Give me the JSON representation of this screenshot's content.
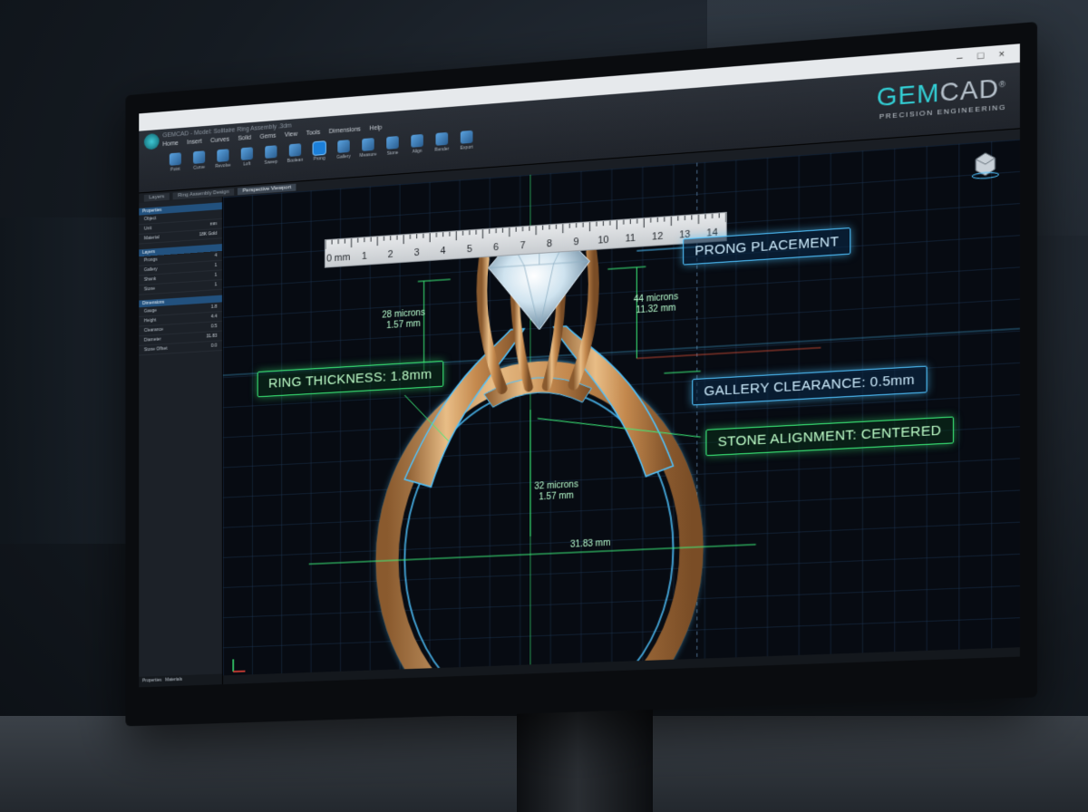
{
  "window": {
    "doc_title": "GEMCAD - Model: Solitaire Ring Assembly .3dm",
    "controls": [
      "–",
      "□",
      "×"
    ]
  },
  "menu": [
    "Home",
    "Insert",
    "Curves",
    "Solid",
    "Gems",
    "View",
    "Tools",
    "Dimensions",
    "Help"
  ],
  "tools": [
    {
      "label": "Point",
      "icon": "point-icon"
    },
    {
      "label": "Curve",
      "icon": "curve-icon"
    },
    {
      "label": "Revolve",
      "icon": "revolve-icon"
    },
    {
      "label": "Loft",
      "icon": "loft-icon"
    },
    {
      "label": "Sweep",
      "icon": "sweep-icon"
    },
    {
      "label": "Boolean",
      "icon": "boolean-icon"
    },
    {
      "label": "Prong",
      "icon": "prong-icon"
    },
    {
      "label": "Gallery",
      "icon": "gallery-icon"
    },
    {
      "label": "Measure",
      "icon": "measure-icon"
    },
    {
      "label": "Stone",
      "icon": "stone-icon"
    },
    {
      "label": "Align",
      "icon": "align-icon"
    },
    {
      "label": "Render",
      "icon": "render-icon"
    },
    {
      "label": "Export",
      "icon": "export-icon"
    }
  ],
  "brand": {
    "name_a": "GEM",
    "name_b": "CAD",
    "reg": "®",
    "tagline": "PRECISION ENGINEERING"
  },
  "tabs": [
    {
      "label": "Layers"
    },
    {
      "label": "Ring Assembly Design"
    },
    {
      "label": "Perspective Viewport"
    }
  ],
  "panel": {
    "section1": "Properties",
    "rows1": [
      {
        "k": "Object",
        "v": ""
      },
      {
        "k": "Unit",
        "v": "mm"
      },
      {
        "k": "Material",
        "v": "18K Gold"
      }
    ],
    "section2": "Layers",
    "rows2": [
      {
        "k": "Prongs",
        "v": "4"
      },
      {
        "k": "Gallery",
        "v": "1"
      },
      {
        "k": "Shank",
        "v": "1"
      },
      {
        "k": "Stone",
        "v": "1"
      }
    ],
    "section3": "Dimensions",
    "rows3": [
      {
        "k": "Gauge",
        "v": "1.8"
      },
      {
        "k": "Height",
        "v": "4.4"
      },
      {
        "k": "Clearance",
        "v": "0.5"
      },
      {
        "k": "Diameter",
        "v": "31.83"
      },
      {
        "k": "Stone Offset",
        "v": "0.0"
      }
    ],
    "footer": [
      "Properties",
      "Materials"
    ]
  },
  "ruler": {
    "labels": [
      "0 mm",
      "1",
      "2",
      "3",
      "4",
      "5",
      "6",
      "7",
      "8",
      "9",
      "10",
      "11",
      "12",
      "13",
      "14"
    ]
  },
  "callouts": {
    "prong": "PRONG PLACEMENT",
    "thickness": "RING THICKNESS: 1.8mm",
    "gallery": "GALLERY CLEARANCE: 0.5mm",
    "stone": "STONE ALIGNMENT: CENTERED"
  },
  "dimensions": {
    "d1_a": "28 microns",
    "d1_b": "1.57 mm",
    "d2_a": "44 microns",
    "d2_b": "11.32 mm",
    "d3_a": "32 microns",
    "d3_b": "1.57 mm",
    "d4": "31.83 mm"
  },
  "colors": {
    "accent_blue": "#4fc3ff",
    "accent_green": "#3cf07a",
    "gold": "#d9a86a",
    "brand_teal": "#33d0d6"
  }
}
